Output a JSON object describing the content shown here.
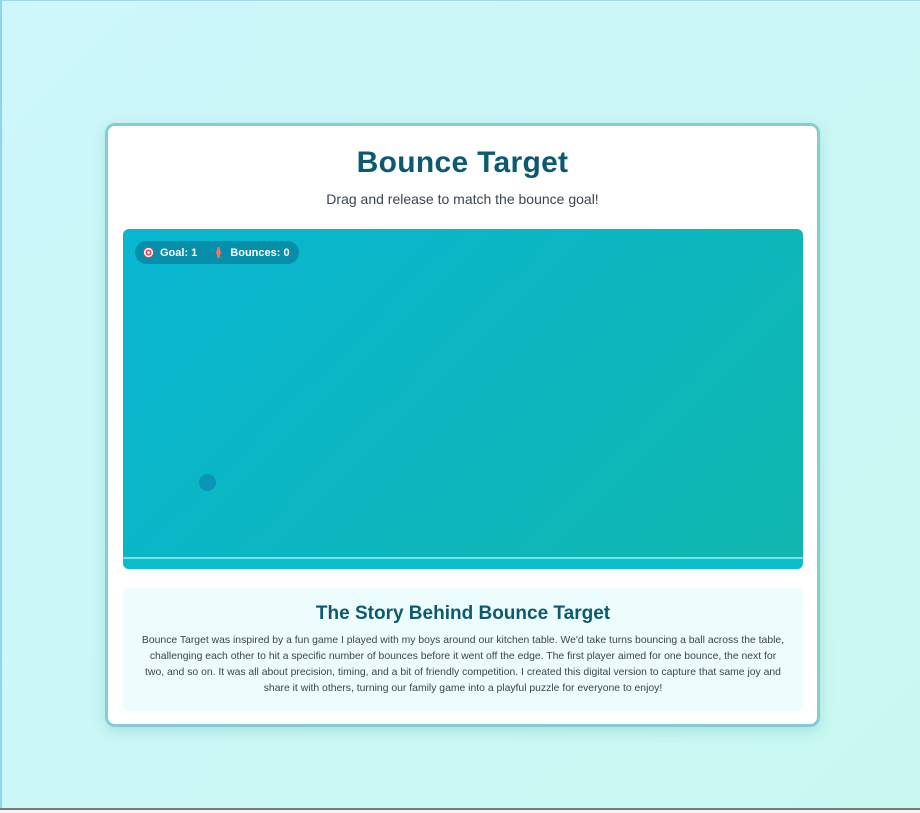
{
  "game": {
    "title": "Bounce Target",
    "subtitle": "Drag and release to match the bounce goal!",
    "hud": {
      "goal_label": "Goal: 1",
      "bounces_label": "Bounces: 0",
      "goal_icon": "target-icon",
      "bounces_icon": "collision-icon"
    }
  },
  "story": {
    "title": "The Story Behind Bounce Target",
    "text": "Bounce Target was inspired by a fun game I played with my boys around our kitchen table. We'd take turns bouncing a ball across the table, challenging each other to hit a specific number of bounces before it went off the edge. The first player aimed for one bounce, the next for two, and so on. It was all about precision, timing, and a bit of friendly competition. I created this digital version to capture that same joy and share it with others, turning our family game into a playful puzzle for everyone to enjoy!"
  },
  "colors": {
    "page_bg": "#cdf7fb",
    "title": "#0b5a70",
    "board_start": "#08b6d2",
    "board_end": "#10b7ae",
    "ball": "#0a8fb4",
    "card_border": "#86ccd4"
  }
}
